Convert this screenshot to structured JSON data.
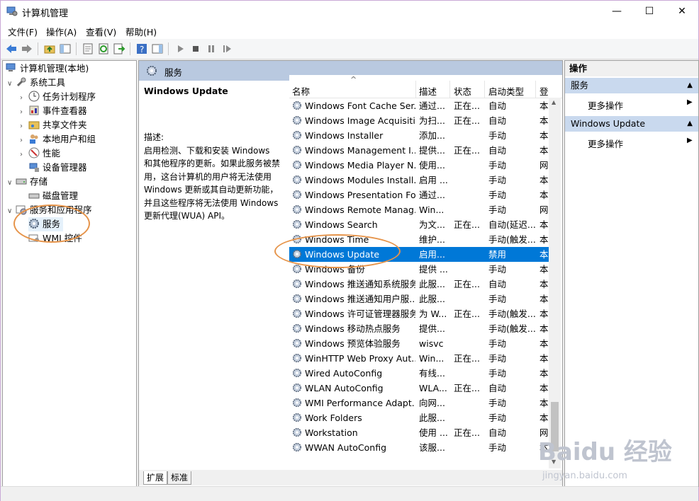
{
  "window": {
    "title": "计算机管理",
    "min": "—",
    "max": "☐",
    "close": "✕"
  },
  "menu": [
    "文件(F)",
    "操作(A)",
    "查看(V)",
    "帮助(H)"
  ],
  "tree": {
    "root": "计算机管理(本地)",
    "system_tools": "系统工具",
    "task_scheduler": "任务计划程序",
    "event_viewer": "事件查看器",
    "shared_folders": "共享文件夹",
    "local_users": "本地用户和组",
    "performance": "性能",
    "device_manager": "设备管理器",
    "storage": "存储",
    "disk_management": "磁盘管理",
    "services_apps": "服务和应用程序",
    "services": "服务",
    "wmi": "WMI 控件"
  },
  "middle": {
    "header": "服务",
    "selected_service": "Windows Update",
    "desc_label": "描述:",
    "desc_text": "启用检测、下载和安装 Windows 和其他程序的更新。如果此服务被禁用，这台计算机的用户将无法使用 Windows 更新或其自动更新功能，并且这些程序将无法使用 Windows 更新代理(WUA) API。",
    "columns": [
      "名称",
      "描述",
      "状态",
      "启动类型",
      "登"
    ],
    "sort_indicator": "^",
    "tabs": [
      "扩展",
      "标准"
    ]
  },
  "services": [
    {
      "name": "Windows Font Cache Ser...",
      "desc": "通过...",
      "status": "正在...",
      "start": "自动",
      "logon": "本"
    },
    {
      "name": "Windows Image Acquisiti...",
      "desc": "为扫...",
      "status": "正在...",
      "start": "自动",
      "logon": "本"
    },
    {
      "name": "Windows Installer",
      "desc": "添加...",
      "status": "",
      "start": "手动",
      "logon": "本"
    },
    {
      "name": "Windows Management I...",
      "desc": "提供...",
      "status": "正在...",
      "start": "自动",
      "logon": "本"
    },
    {
      "name": "Windows Media Player N...",
      "desc": "使用...",
      "status": "",
      "start": "手动",
      "logon": "网"
    },
    {
      "name": "Windows Modules Install...",
      "desc": "启用 ...",
      "status": "",
      "start": "手动",
      "logon": "本"
    },
    {
      "name": "Windows Presentation Fo...",
      "desc": "通过...",
      "status": "",
      "start": "手动",
      "logon": "本"
    },
    {
      "name": "Windows Remote Manag...",
      "desc": "Win...",
      "status": "",
      "start": "手动",
      "logon": "网"
    },
    {
      "name": "Windows Search",
      "desc": "为文...",
      "status": "正在...",
      "start": "自动(延迟...",
      "logon": "本"
    },
    {
      "name": "Windows Time",
      "desc": "维护...",
      "status": "",
      "start": "手动(触发...",
      "logon": "本"
    },
    {
      "name": "Windows Update",
      "desc": "启用...",
      "status": "",
      "start": "禁用",
      "logon": "本"
    },
    {
      "name": "Windows 备份",
      "desc": "提供 ...",
      "status": "",
      "start": "手动",
      "logon": "本"
    },
    {
      "name": "Windows 推送通知系统服务",
      "desc": "此服...",
      "status": "正在...",
      "start": "自动",
      "logon": "本"
    },
    {
      "name": "Windows 推送通知用户服...",
      "desc": "此服...",
      "status": "",
      "start": "手动",
      "logon": "本"
    },
    {
      "name": "Windows 许可证管理器服务",
      "desc": "为 W...",
      "status": "正在...",
      "start": "手动(触发...",
      "logon": "本"
    },
    {
      "name": "Windows 移动热点服务",
      "desc": "提供...",
      "status": "",
      "start": "手动(触发...",
      "logon": "本"
    },
    {
      "name": "Windows 预览体验服务",
      "desc": "wisvc",
      "status": "",
      "start": "手动",
      "logon": "本"
    },
    {
      "name": "WinHTTP Web Proxy Aut...",
      "desc": "Win...",
      "status": "正在...",
      "start": "手动",
      "logon": "本"
    },
    {
      "name": "Wired AutoConfig",
      "desc": "有线...",
      "status": "",
      "start": "手动",
      "logon": "本"
    },
    {
      "name": "WLAN AutoConfig",
      "desc": "WLA...",
      "status": "正在...",
      "start": "自动",
      "logon": "本"
    },
    {
      "name": "WMI Performance Adapt...",
      "desc": "向网...",
      "status": "",
      "start": "手动",
      "logon": "本"
    },
    {
      "name": "Work Folders",
      "desc": "此服...",
      "status": "",
      "start": "手动",
      "logon": "本"
    },
    {
      "name": "Workstation",
      "desc": "使用 ...",
      "status": "正在...",
      "start": "自动",
      "logon": "网"
    },
    {
      "name": "WWAN AutoConfig",
      "desc": "该服...",
      "status": "",
      "start": "手动",
      "logon": "本"
    }
  ],
  "actions": {
    "header": "操作",
    "section1": "服务",
    "section1_item": "更多操作",
    "section2": "Windows Update",
    "section2_item": "更多操作"
  },
  "watermark": {
    "brand": "Baidu 经验",
    "url": "jingyan.baidu.com"
  },
  "colors": {
    "selection": "#0078d7",
    "header_bar": "#b9c9e0",
    "annotation": "#e6944a"
  }
}
